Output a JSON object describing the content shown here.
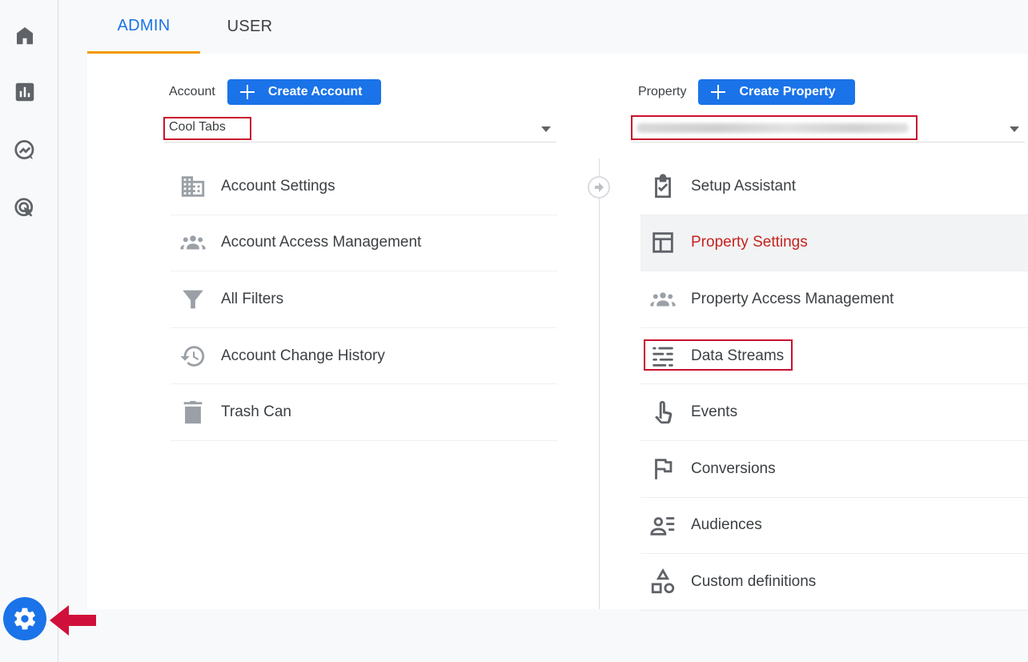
{
  "tabs": {
    "admin": "ADMIN",
    "user": "USER"
  },
  "account": {
    "label": "Account",
    "create_button": "Create Account",
    "selected": "Cool Tabs",
    "items": [
      {
        "label": "Account Settings",
        "icon": "building-icon"
      },
      {
        "label": "Account Access Management",
        "icon": "people-icon"
      },
      {
        "label": "All Filters",
        "icon": "filter-icon"
      },
      {
        "label": "Account Change History",
        "icon": "history-icon"
      },
      {
        "label": "Trash Can",
        "icon": "trash-icon"
      }
    ]
  },
  "property": {
    "label": "Property",
    "create_button": "Create Property",
    "selected_blurred": true,
    "items": [
      {
        "label": "Setup Assistant",
        "icon": "checklist-icon"
      },
      {
        "label": "Property Settings",
        "icon": "layout-icon",
        "active": true
      },
      {
        "label": "Property Access Management",
        "icon": "people-icon"
      },
      {
        "label": "Data Streams",
        "icon": "data-streams-icon"
      },
      {
        "label": "Events",
        "icon": "touch-icon"
      },
      {
        "label": "Conversions",
        "icon": "flag-icon"
      },
      {
        "label": "Audiences",
        "icon": "audience-icon"
      },
      {
        "label": "Custom definitions",
        "icon": "shapes-icon"
      }
    ]
  },
  "nav": [
    "home-icon",
    "reports-icon",
    "explore-icon",
    "advertising-icon",
    "admin-gear-icon"
  ],
  "colors": {
    "accent": "#1a73e8",
    "highlight": "#c8102e",
    "active_text": "#c5221f",
    "tab_underline": "#f29900"
  }
}
